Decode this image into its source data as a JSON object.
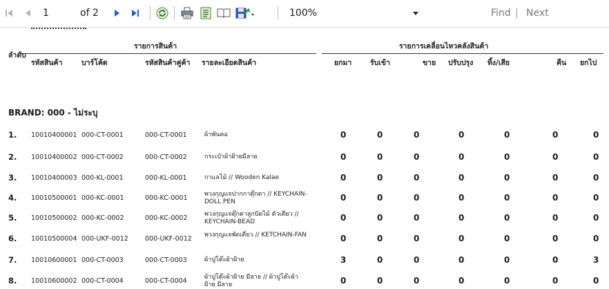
{
  "toolbar": {
    "page_current": "1",
    "page_of": "of 2",
    "zoom": "100%",
    "find_label": "Find",
    "separator": "|",
    "next_label": "Next"
  },
  "report": {
    "col_index": "ลำดับ",
    "group_product": "รายการสินค้า",
    "group_movement": "รายการเคลื่อนไหวคลังสินค้า",
    "col_product_code": "รหัสสินค้า",
    "col_barcode": "บาร์โค้ด",
    "col_partner_code": "รหัสสินค้าคู่ค้า",
    "col_description": "รายละเอียดสินค้า",
    "col_carry_in": "ยกมา",
    "col_receive": "รับเข้า",
    "col_sell": "ขาย",
    "col_adjust": "ปรับปรุง",
    "col_discard": "ทิ้ง/เสีย",
    "col_return": "คืน",
    "col_carry_out": "ยกไป",
    "brand": "BRAND: 000 - ไม่ระบุ",
    "rows": [
      {
        "idx": "1.",
        "code": "10010400001",
        "barcode": "000-CT-0001",
        "partner": "000-CT-0001",
        "desc": "ผ้าพันคอ",
        "v": [
          "0",
          "0",
          "0",
          "0",
          "0",
          "0",
          "0"
        ]
      },
      {
        "idx": "2.",
        "code": "10010400002",
        "barcode": "000-CT-0002",
        "partner": "000-CT-0002",
        "desc": "กระเป๋าผ้าฝ้ายมีลาย",
        "v": [
          "0",
          "0",
          "0",
          "0",
          "0",
          "0",
          "0"
        ]
      },
      {
        "idx": "3.",
        "code": "10010400003",
        "barcode": "000-KL-0001",
        "partner": "000-KL-0001",
        "desc": "กาแลไม้ // Wooden Kalae",
        "v": [
          "0",
          "0",
          "0",
          "0",
          "0",
          "0",
          "0"
        ]
      },
      {
        "idx": "4.",
        "code": "10010500001",
        "barcode": "000-KC-0001",
        "partner": "000-KC-0001",
        "desc": "พวงกุญแจปากกาตุ๊กตา // KEYCHAIN-DOLL PEN",
        "v": [
          "0",
          "0",
          "0",
          "0",
          "0",
          "0",
          "0"
        ]
      },
      {
        "idx": "5.",
        "code": "10010500002",
        "barcode": "000-KC-0002",
        "partner": "000-KC-0002",
        "desc": "พวงกุญแจตุ๊กตาลูกปัดไม้ ตัวเดียว // KEYCHAIN-BEAD",
        "v": [
          "0",
          "0",
          "0",
          "0",
          "0",
          "0",
          "0"
        ]
      },
      {
        "idx": "6.",
        "code": "10010500004",
        "barcode": "000-UKF-0012",
        "partner": "000-UKF-0012",
        "desc": "พวงกุญแจพัดเดี่ยว // KETCHAIN-FAN",
        "v": [
          "0",
          "0",
          "0",
          "0",
          "0",
          "0",
          "0"
        ]
      },
      {
        "idx": "7.",
        "code": "10010600001",
        "barcode": "000-CT-0003",
        "partner": "000-CT-0003",
        "desc": "ผ้าปูโต๊ะผ้าฝ้าย",
        "v": [
          "3",
          "0",
          "0",
          "0",
          "0",
          "0",
          "3"
        ]
      },
      {
        "idx": "8.",
        "code": "10010600002",
        "barcode": "000-CT-0004",
        "partner": "000-CT-0004",
        "desc": "ผ้าปูโต๊ะผ้าฝ้าย มีลาย // ผ้าปูโต๊ะผ้าฝ้าย มีลาย",
        "v": [
          "0",
          "0",
          "0",
          "0",
          "0",
          "0",
          "0"
        ]
      }
    ]
  },
  "colors": {
    "nav_disabled": "#b5b5b5",
    "nav_active": "#1f5fbf",
    "text_muted": "#7a7a7a"
  }
}
